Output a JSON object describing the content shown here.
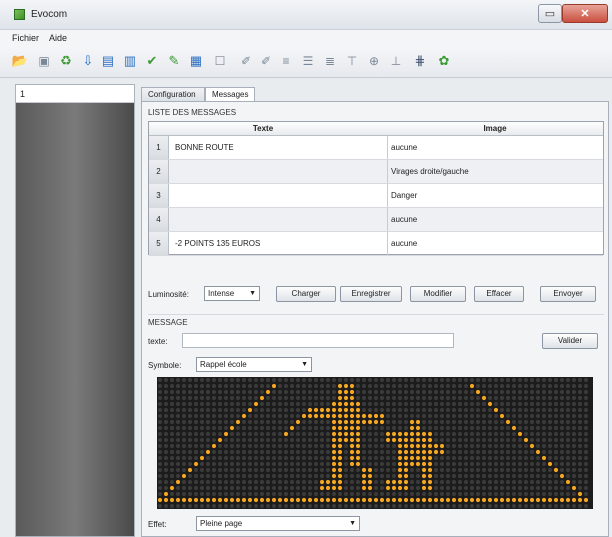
{
  "window": {
    "title": "Evocom",
    "minimize_label": "▭",
    "close_label": "✕"
  },
  "menu": [
    "Fichier",
    "Aide"
  ],
  "toolbar": {
    "icons": [
      {
        "name": "open-folder-icon",
        "glyph": "📂",
        "tone": "blue"
      },
      {
        "name": "page-icon",
        "glyph": "▣",
        "tone": "gray"
      },
      {
        "name": "refresh-icon",
        "glyph": "♻",
        "tone": "green"
      },
      {
        "name": "download-icon",
        "glyph": "⇩",
        "tone": "blue"
      },
      {
        "name": "save-icon",
        "glyph": "▤",
        "tone": "blue"
      },
      {
        "name": "book-icon",
        "glyph": "▥",
        "tone": "blue"
      },
      {
        "name": "check-icon",
        "glyph": "✔",
        "tone": "green"
      },
      {
        "name": "tools-icon",
        "glyph": "✎",
        "tone": "green"
      },
      {
        "name": "image-icon",
        "glyph": "▦",
        "tone": "blue"
      },
      {
        "name": "blank-page-icon",
        "glyph": "☐",
        "tone": "gray"
      },
      {
        "name": "edit-page-icon",
        "glyph": "✐",
        "tone": "gray"
      },
      {
        "name": "edit-page-2-icon",
        "glyph": "✐",
        "tone": "gray"
      },
      {
        "name": "align-left-icon",
        "glyph": "≡",
        "tone": "gray"
      },
      {
        "name": "align-center-icon",
        "glyph": "☰",
        "tone": "gray"
      },
      {
        "name": "align-right-icon",
        "glyph": "≣",
        "tone": "gray"
      },
      {
        "name": "align-top-icon",
        "glyph": "⊤",
        "tone": "gray"
      },
      {
        "name": "align-middle-icon",
        "glyph": "⊕",
        "tone": "gray"
      },
      {
        "name": "align-bottom-icon",
        "glyph": "⊥",
        "tone": "gray"
      },
      {
        "name": "grid-icon",
        "glyph": "⋕",
        "tone": "dark"
      },
      {
        "name": "paint-icon",
        "glyph": "✿",
        "tone": "green"
      }
    ]
  },
  "left_panel": {
    "value": "1"
  },
  "tabs": [
    {
      "label": "Configuration",
      "active": false
    },
    {
      "label": "Messages",
      "active": true
    }
  ],
  "messages": {
    "title": "LISTE DES MESSAGES",
    "columns": [
      "Texte",
      "Image"
    ],
    "rows": [
      {
        "num": "1",
        "text": "BONNE ROUTE",
        "image": "aucune"
      },
      {
        "num": "2",
        "text": "",
        "image": "Virages droite/gauche"
      },
      {
        "num": "3",
        "text": "",
        "image": "Danger"
      },
      {
        "num": "4",
        "text": "",
        "image": "aucune"
      },
      {
        "num": "5",
        "text": "-2 POINTS 135 EUROS",
        "image": "aucune"
      }
    ]
  },
  "controls": {
    "brightness_label": "Luminosité:",
    "brightness_value": "Intense",
    "buttons": [
      "Charger",
      "Enregistrer",
      "Modifier",
      "Effacer",
      "Envoyer"
    ]
  },
  "message_form": {
    "title": "MESSAGE",
    "text_label": "texte:",
    "text_value": "",
    "validate_label": "Valider",
    "symbol_label": "Symbole:",
    "symbol_value": "Rappel école",
    "effect_label": "Effet:",
    "effect_value": "Pleine page"
  },
  "led_colors": {
    "on": "#f5a623",
    "off": "#3a3a3a",
    "background": "#1c1c1c"
  }
}
